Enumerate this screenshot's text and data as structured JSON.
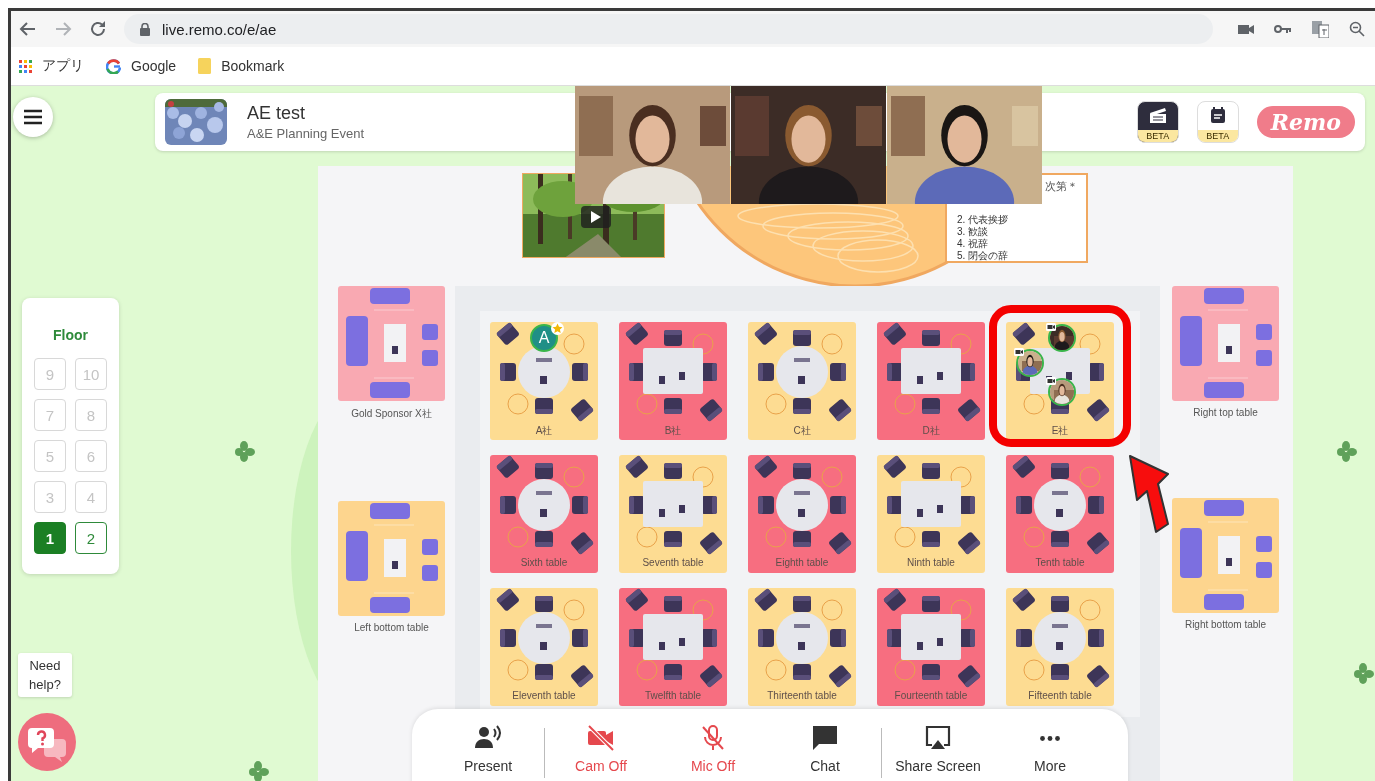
{
  "browser": {
    "url": "live.remo.co/e/ae",
    "bookmarks": [
      {
        "label": "アプリ",
        "kind": "apps"
      },
      {
        "label": "Google",
        "kind": "google"
      },
      {
        "label": "Bookmark",
        "kind": "folder"
      }
    ]
  },
  "event": {
    "title": "AE test",
    "subtitle": "A&E Planning Event",
    "logo": "Remo",
    "badges": [
      {
        "label": "BETA",
        "kind": "clapper"
      },
      {
        "label": "BETA",
        "kind": "calendar"
      }
    ]
  },
  "stage": {
    "agenda": {
      "title": "次第＊",
      "items": [
        "2. 代表挨拶",
        "3. 歓談",
        "4. 祝辞",
        "5. 閉会の辞"
      ]
    }
  },
  "left_rooms": [
    {
      "label": "Gold Sponsor X社",
      "color": "#f9a9b2"
    },
    {
      "label": "Left bottom table",
      "color": "#fdd58e"
    }
  ],
  "right_rooms": [
    {
      "label": "Right top table",
      "color": "#f9a9b2"
    },
    {
      "label": "Right bottom table",
      "color": "#fdd58e"
    }
  ],
  "tables": [
    {
      "label": "A社",
      "color": "#fddc92",
      "kind": "round",
      "highlighted": false,
      "avatars": [
        {
          "kind": "letter",
          "letter": "A"
        }
      ]
    },
    {
      "label": "B社",
      "color": "#f76e80",
      "kind": "rect",
      "highlighted": false
    },
    {
      "label": "C社",
      "color": "#fddc92",
      "kind": "round",
      "highlighted": false
    },
    {
      "label": "D社",
      "color": "#f76e80",
      "kind": "rect",
      "highlighted": false
    },
    {
      "label": "E社",
      "color": "#fddc92",
      "kind": "rect",
      "highlighted": true
    },
    {
      "label": "Sixth table",
      "color": "#f76e80",
      "kind": "round",
      "highlighted": false
    },
    {
      "label": "Seventh table",
      "color": "#fddc92",
      "kind": "rect",
      "highlighted": false
    },
    {
      "label": "Eighth table",
      "color": "#f76e80",
      "kind": "round",
      "highlighted": false
    },
    {
      "label": "Ninth table",
      "color": "#fddc92",
      "kind": "rect",
      "highlighted": false
    },
    {
      "label": "Tenth table",
      "color": "#f76e80",
      "kind": "round",
      "highlighted": false
    },
    {
      "label": "Eleventh table",
      "color": "#fddc92",
      "kind": "round",
      "highlighted": false
    },
    {
      "label": "Twelfth table",
      "color": "#f76e80",
      "kind": "rect",
      "highlighted": false
    },
    {
      "label": "Thirteenth table",
      "color": "#fddc92",
      "kind": "round",
      "highlighted": false
    },
    {
      "label": "Fourteenth table",
      "color": "#f76e80",
      "kind": "rect",
      "highlighted": false
    },
    {
      "label": "Fifteenth table",
      "color": "#fddc92",
      "kind": "round",
      "highlighted": false
    }
  ],
  "floors": {
    "title": "Floor",
    "buttons": [
      {
        "label": "9",
        "selected": false,
        "disabled": true
      },
      {
        "label": "10",
        "selected": false,
        "disabled": true
      },
      {
        "label": "7",
        "selected": false,
        "disabled": true
      },
      {
        "label": "8",
        "selected": false,
        "disabled": true
      },
      {
        "label": "5",
        "selected": false,
        "disabled": true
      },
      {
        "label": "6",
        "selected": false,
        "disabled": true
      },
      {
        "label": "3",
        "selected": false,
        "disabled": true
      },
      {
        "label": "4",
        "selected": false,
        "disabled": true
      },
      {
        "label": "1",
        "selected": true,
        "disabled": false
      },
      {
        "label": "2",
        "selected": false,
        "disabled": false
      }
    ]
  },
  "help": {
    "tooltip": "Need help?"
  },
  "controls": [
    {
      "label": "Present",
      "kind": "present",
      "off": false,
      "separated": true
    },
    {
      "label": "Cam Off",
      "kind": "camera",
      "off": true,
      "separated": false
    },
    {
      "label": "Mic Off",
      "kind": "mic",
      "off": true,
      "separated": false
    },
    {
      "label": "Chat",
      "kind": "chat",
      "off": false,
      "separated": true
    },
    {
      "label": "Share Screen",
      "kind": "share",
      "off": false,
      "separated": false
    },
    {
      "label": "More",
      "kind": "more",
      "off": false,
      "separated": false
    }
  ]
}
